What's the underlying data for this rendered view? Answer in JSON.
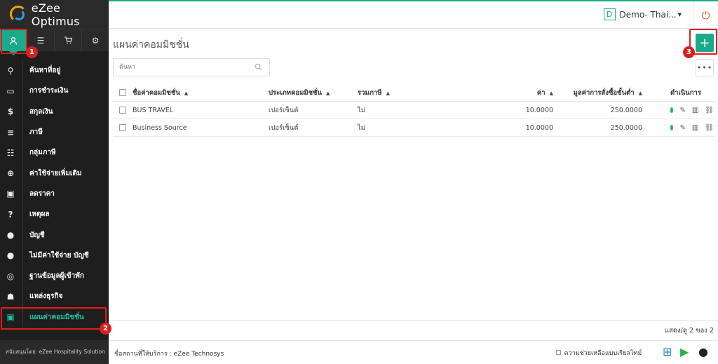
{
  "app": {
    "logo_text": "eZee Optimus"
  },
  "sidebar": {
    "tabs": [
      {
        "icon": "user-icon"
      },
      {
        "icon": "list-icon"
      },
      {
        "icon": "cart-icon"
      },
      {
        "icon": "gear-icon"
      }
    ],
    "items": [
      {
        "label": "ค้นหาที่อยู่",
        "icon": "map-pin-icon"
      },
      {
        "label": "การชำระเงิน",
        "icon": "credit-card-icon"
      },
      {
        "label": "สกุลเงิน",
        "icon": "dollar-icon"
      },
      {
        "label": "ภาษี",
        "icon": "menu-icon"
      },
      {
        "label": "กลุ่มภาษี",
        "icon": "list-icon"
      },
      {
        "label": "ค่าใช้จ่ายเพิ่มเติม",
        "icon": "plus-circle-icon"
      },
      {
        "label": "ลดราคา",
        "icon": "gift-icon"
      },
      {
        "label": "เหตุผล",
        "icon": "question-icon"
      },
      {
        "label": "บัญชี",
        "icon": "user-icon"
      },
      {
        "label": "ไม่มีค่าใช้จ่าย บัญชี",
        "icon": "user-icon"
      },
      {
        "label": "ฐานข้อมูลผู้เข้าพัก",
        "icon": "database-icon"
      },
      {
        "label": "แหล่งธุรกิจ",
        "icon": "users-icon"
      },
      {
        "label": "แผนค่าคอมมิชชั่น",
        "icon": "money-icon",
        "active": true
      }
    ],
    "footer": "สนับสนุนโดย: eZee Hospitality Solution"
  },
  "topbar": {
    "hotel_badge": "D",
    "hotel_name": "Demo- Thai..."
  },
  "page": {
    "title": "แผนค่าคอมมิชชั่น",
    "search_placeholder": "ค้นหา",
    "add_label": "+",
    "more_label": "•••"
  },
  "table": {
    "headers": {
      "name": "ชื่อค่าคอมมิชชั่น",
      "type": "ประเภทคอมมิชชั่น",
      "tax": "รวมภาษี",
      "value": "ค่า",
      "min": "มูลค่าการสั่งซื้อขั้นต่ำ",
      "action": "ดำเนินการ"
    },
    "rows": [
      {
        "name": "BUS TRAVEL",
        "type": "เปอร์เซ็นต์",
        "tax": "ไม่",
        "value": "10.0000",
        "min": "250.0000"
      },
      {
        "name": "Business Source",
        "type": "เปอร์เซ็นต์",
        "tax": "ไม่",
        "value": "10.0000",
        "min": "250.0000"
      }
    ]
  },
  "pager": "แสดง/ดู 2 ของ 2",
  "bottombar": {
    "property": "ชื่อสถานที่ให้บริการ : eZee Technosys",
    "help": "ความช่วยเหลือแบบเรียลไทม์"
  },
  "annotations": [
    "1",
    "2",
    "3"
  ],
  "colors": {
    "accent": "#1aaa8a",
    "sidebar": "#1e1e1e",
    "callout": "#e21b1b",
    "status": "#2bb34a",
    "power": "#e05a3a"
  }
}
